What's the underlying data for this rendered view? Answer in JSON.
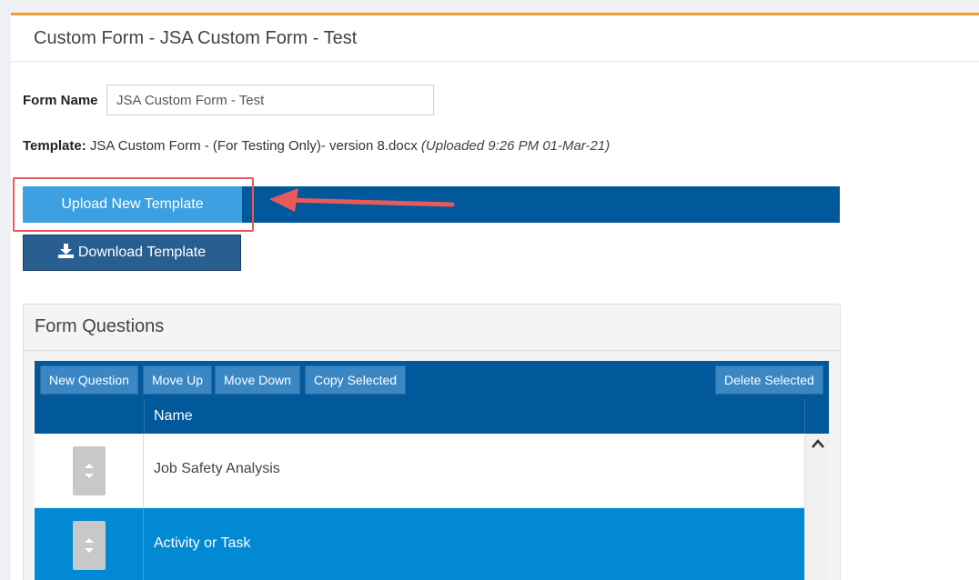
{
  "header": {
    "title": "Custom Form - JSA Custom Form - Test"
  },
  "form": {
    "name_label": "Form Name",
    "name_value": "JSA Custom Form - Test",
    "template_label": "Template:",
    "template_file": "JSA Custom Form - (For Testing Only)- version 8.docx",
    "template_uploaded": "(Uploaded 9:26 PM 01-Mar-21)"
  },
  "actions": {
    "upload_label": "Upload New Template",
    "download_label": "Download Template"
  },
  "questions": {
    "title": "Form Questions",
    "toolbar": {
      "new_question": "New Question",
      "move_up": "Move Up",
      "move_down": "Move Down",
      "copy_selected": "Copy Selected",
      "delete_selected": "Delete Selected"
    },
    "columns": {
      "name": "Name"
    },
    "rows": [
      {
        "name": "Job Safety Analysis",
        "selected": false
      },
      {
        "name": "Activity or Task",
        "selected": true
      }
    ]
  },
  "colors": {
    "accent_top": "#f0a02a",
    "primary_dark": "#01589b",
    "upload_button": "#3da0e0",
    "selected_row": "#0189d3",
    "annotation": "#e85a5a"
  },
  "icons": [
    "download-icon",
    "drag-handle-icon",
    "chevron-up-icon",
    "annotation-arrow"
  ]
}
